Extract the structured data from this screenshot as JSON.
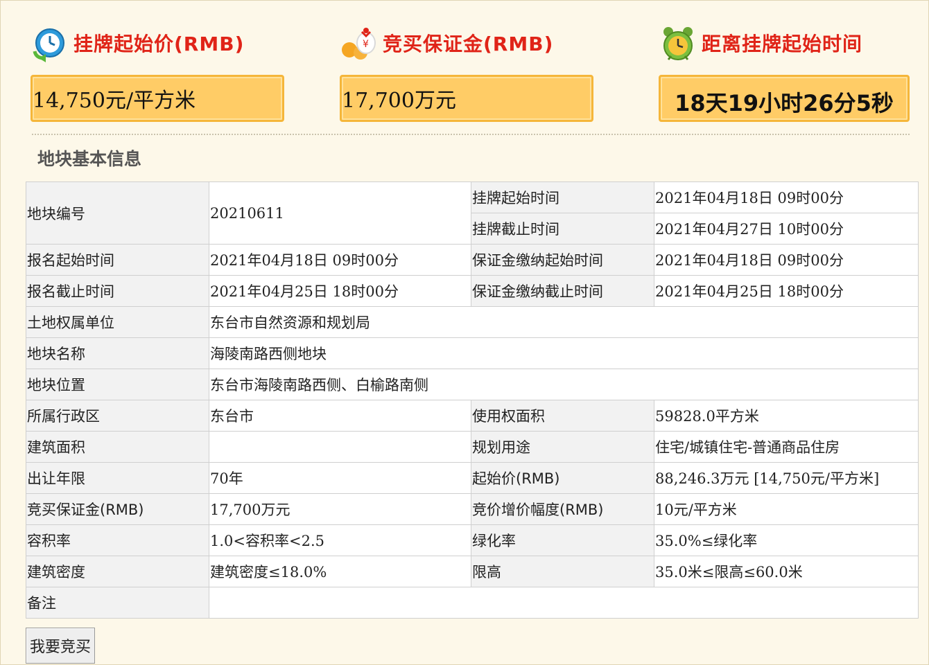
{
  "summary": {
    "start_price": {
      "label": "挂牌起始价(RMB)",
      "value": "14,750元/平方米",
      "icon": "clock-refresh-icon"
    },
    "deposit": {
      "label": "竞买保证金(RMB)",
      "value": "17,700万元",
      "icon": "money-bag-icon"
    },
    "countdown": {
      "label": "距离挂牌起始时间",
      "value": "18天19小时26分5秒",
      "icon": "alarm-clock-icon"
    }
  },
  "section_title": "地块基本信息",
  "table": {
    "parcel_no": {
      "label": "地块编号",
      "value": "20210611"
    },
    "listing_start": {
      "label": "挂牌起始时间",
      "value": "2021年04月18日 09时00分"
    },
    "listing_end": {
      "label": "挂牌截止时间",
      "value": "2021年04月27日 10时00分"
    },
    "reg_start": {
      "label": "报名起始时间",
      "value": "2021年04月18日 09时00分"
    },
    "deposit_start": {
      "label": "保证金缴纳起始时间",
      "value": "2021年04月18日 09时00分"
    },
    "reg_end": {
      "label": "报名截止时间",
      "value": "2021年04月25日 18时00分"
    },
    "deposit_end": {
      "label": "保证金缴纳截止时间",
      "value": "2021年04月25日 18时00分"
    },
    "owner": {
      "label": "土地权属单位",
      "value": "东台市自然资源和规划局"
    },
    "name": {
      "label": "地块名称",
      "value": "海陵南路西侧地块"
    },
    "location": {
      "label": "地块位置",
      "value": "东台市海陵南路西侧、白榆路南侧"
    },
    "district": {
      "label": "所属行政区",
      "value": "东台市"
    },
    "use_area": {
      "label": "使用权面积",
      "value": "59828.0平方米"
    },
    "build_area": {
      "label": "建筑面积",
      "value": ""
    },
    "planned_use": {
      "label": "规划用途",
      "value": "住宅/城镇住宅-普通商品住房"
    },
    "term": {
      "label": "出让年限",
      "value": "70年"
    },
    "start_price": {
      "label": "起始价(RMB)",
      "value": "88,246.3万元 [14,750元/平方米]"
    },
    "deposit": {
      "label": "竞买保证金(RMB)",
      "value": "17,700万元"
    },
    "increment": {
      "label": "竞价增价幅度(RMB)",
      "value": "10元/平方米"
    },
    "far": {
      "label": "容积率",
      "value": "1.0<容积率<2.5"
    },
    "green": {
      "label": "绿化率",
      "value": "35.0%≤绿化率"
    },
    "density": {
      "label": "建筑密度",
      "value": "建筑密度≤18.0%"
    },
    "height": {
      "label": "限高",
      "value": "35.0米≤限高≤60.0米"
    },
    "remarks": {
      "label": "备注",
      "value": ""
    }
  },
  "bid_button_label": "我要竞买"
}
